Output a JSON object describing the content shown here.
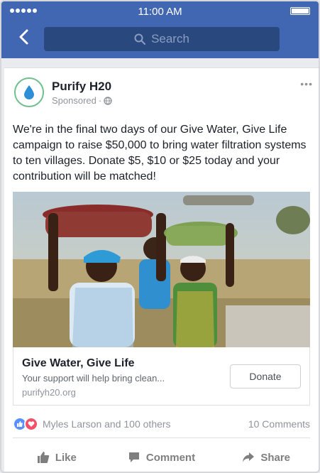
{
  "status_bar": {
    "time": "11:00 AM"
  },
  "header": {
    "search_placeholder": "Search"
  },
  "post": {
    "page_name": "Purify H20",
    "sponsored_label": "Sponsored",
    "text": "We're in the final two days of our Give Water, Give Life campaign to raise $50,000 to bring water filtration systems to ten villages. Donate $5, $10 or $25 today and your contribution will be matched!",
    "link": {
      "title": "Give Water, Give Life",
      "description": "Your support will help bring clean...",
      "domain": "purifyh20.org",
      "cta_label": "Donate"
    },
    "reactions": {
      "names": "Myles Larson and 100 others",
      "comments": "10 Comments"
    },
    "actions": {
      "like": "Like",
      "comment": "Comment",
      "share": "Share"
    }
  },
  "colors": {
    "header": "#4267b2",
    "search_bg": "#29487d",
    "like": "#5890ff",
    "love": "#f25268"
  }
}
